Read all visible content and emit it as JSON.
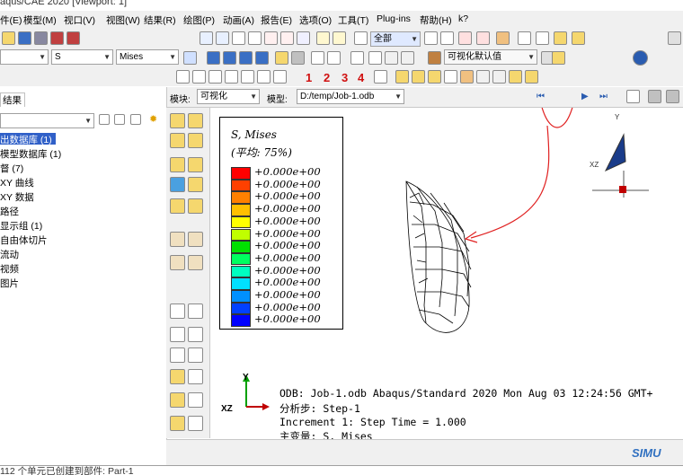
{
  "window_title": "aqus/CAE 2020 [Viewport: 1]",
  "menu": [
    "件(E)",
    "模型(M)",
    "视口(V)",
    "视图(W)",
    "结果(R)",
    "绘图(P)",
    "动画(A)",
    "报告(E)",
    "选项(O)",
    "工具(T)",
    "Plug-ins",
    "帮助(H)",
    "k?"
  ],
  "toolbar": {
    "select_all": "全部",
    "field_category": "S",
    "field_invariant": "Mises",
    "view_default": "可视化默认值",
    "numbers": [
      "1",
      "2",
      "3",
      "4"
    ]
  },
  "context": {
    "module_label": "模块:",
    "module_value": "可视化",
    "model_label": "模型:",
    "model_value": "D:/temp/Job-1.odb"
  },
  "left_panel": {
    "tab": "结果",
    "filter_value": "",
    "tree": [
      "出数据库 (1)",
      "模型数据库 (1)",
      "督 (7)",
      "XY 曲线",
      "XY 数据",
      "路径",
      "显示组 (1)",
      "自由体切片",
      "流动",
      "视频",
      "图片"
    ]
  },
  "legend": {
    "title": "S, Mises",
    "subtitle": "(平均: 75%)",
    "values": [
      "+0.000e+00",
      "+0.000e+00",
      "+0.000e+00",
      "+0.000e+00",
      "+0.000e+00",
      "+0.000e+00",
      "+0.000e+00",
      "+0.000e+00",
      "+0.000e+00",
      "+0.000e+00",
      "+0.000e+00",
      "+0.000e+00",
      "+0.000e+00"
    ],
    "colors": [
      "#ff0000",
      "#ff4000",
      "#ff8000",
      "#ffc000",
      "#ffff00",
      "#c0ff00",
      "#00e000",
      "#00ff60",
      "#00ffc0",
      "#00e0ff",
      "#0090ff",
      "#0040ff",
      "#0000ff"
    ]
  },
  "triad": {
    "y": "Y",
    "xz": "XZ"
  },
  "triad_small": {
    "y": "Y",
    "xz": "XZ"
  },
  "info": {
    "odb": "ODB: Job-1.odb    Abaqus/Standard 2020    Mon Aug 03 12:24:56 GMT+",
    "step": "分析步: Step-1",
    "increment": "Increment     1: Step Time =    1.000",
    "primary": "主变量: S, Mises"
  },
  "brand": "SIMU",
  "message": "112 个单元已创建到部件: Part-1"
}
